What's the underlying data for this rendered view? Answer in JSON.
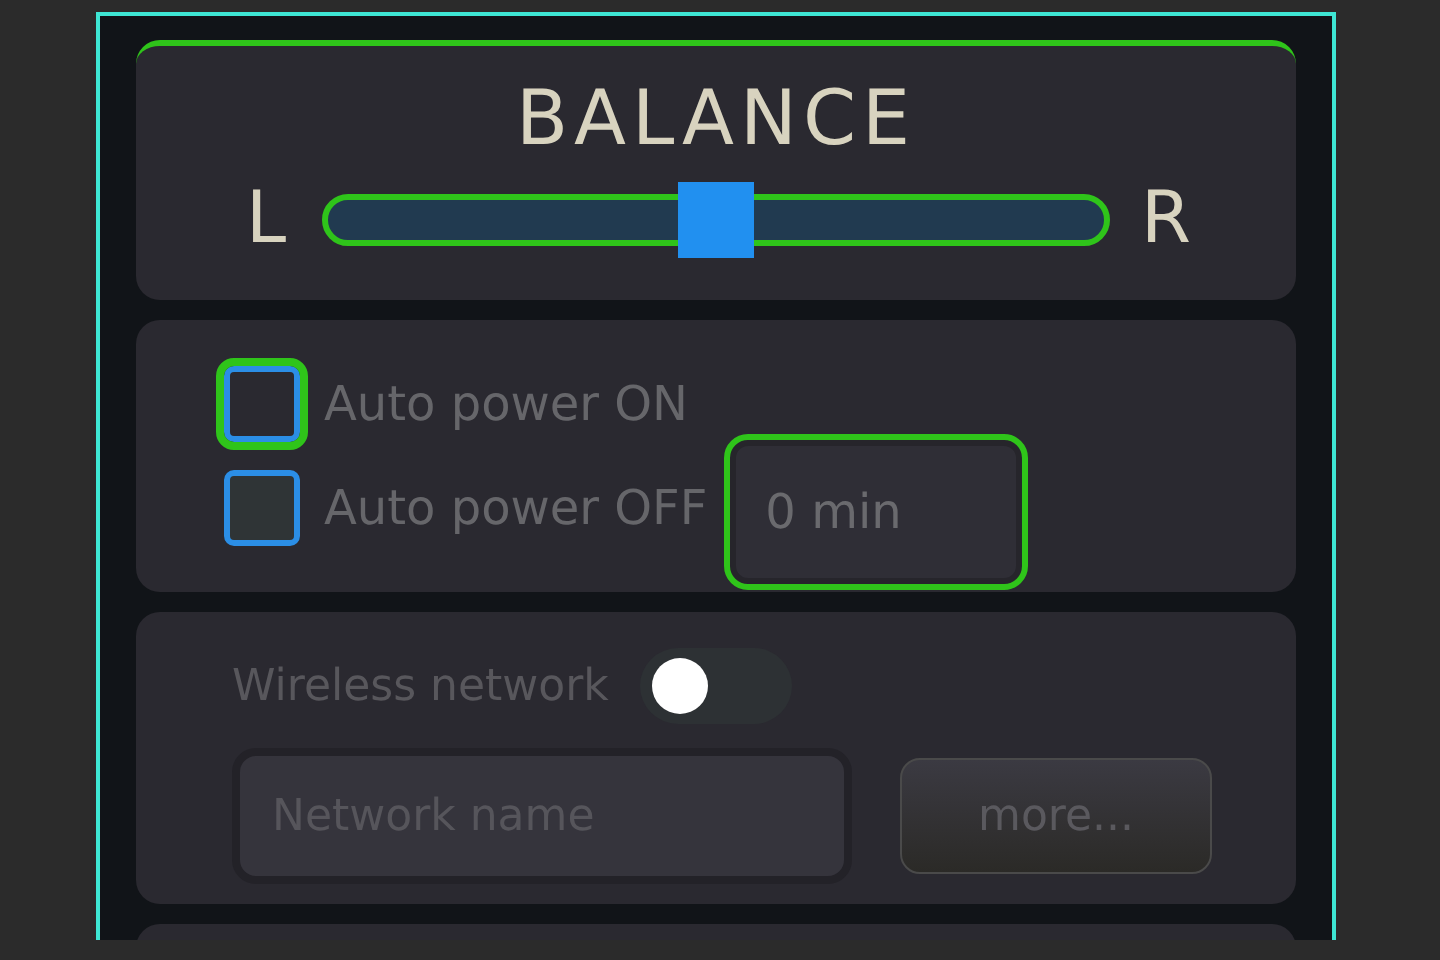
{
  "balance": {
    "title": "BALANCE",
    "left_label": "L",
    "right_label": "R",
    "level": 0.5,
    "focused": true
  },
  "power": {
    "options": [
      {
        "label": "Auto power ON",
        "checked": false,
        "focused": true
      },
      {
        "label": "Auto power OFF",
        "checked": false,
        "focused": false
      }
    ],
    "delay": {
      "value": "0 min",
      "focused": true
    }
  },
  "wireless": {
    "label": "Wireless network",
    "on": false,
    "network": {
      "placeholder": "Network name"
    },
    "button": "more..."
  }
}
